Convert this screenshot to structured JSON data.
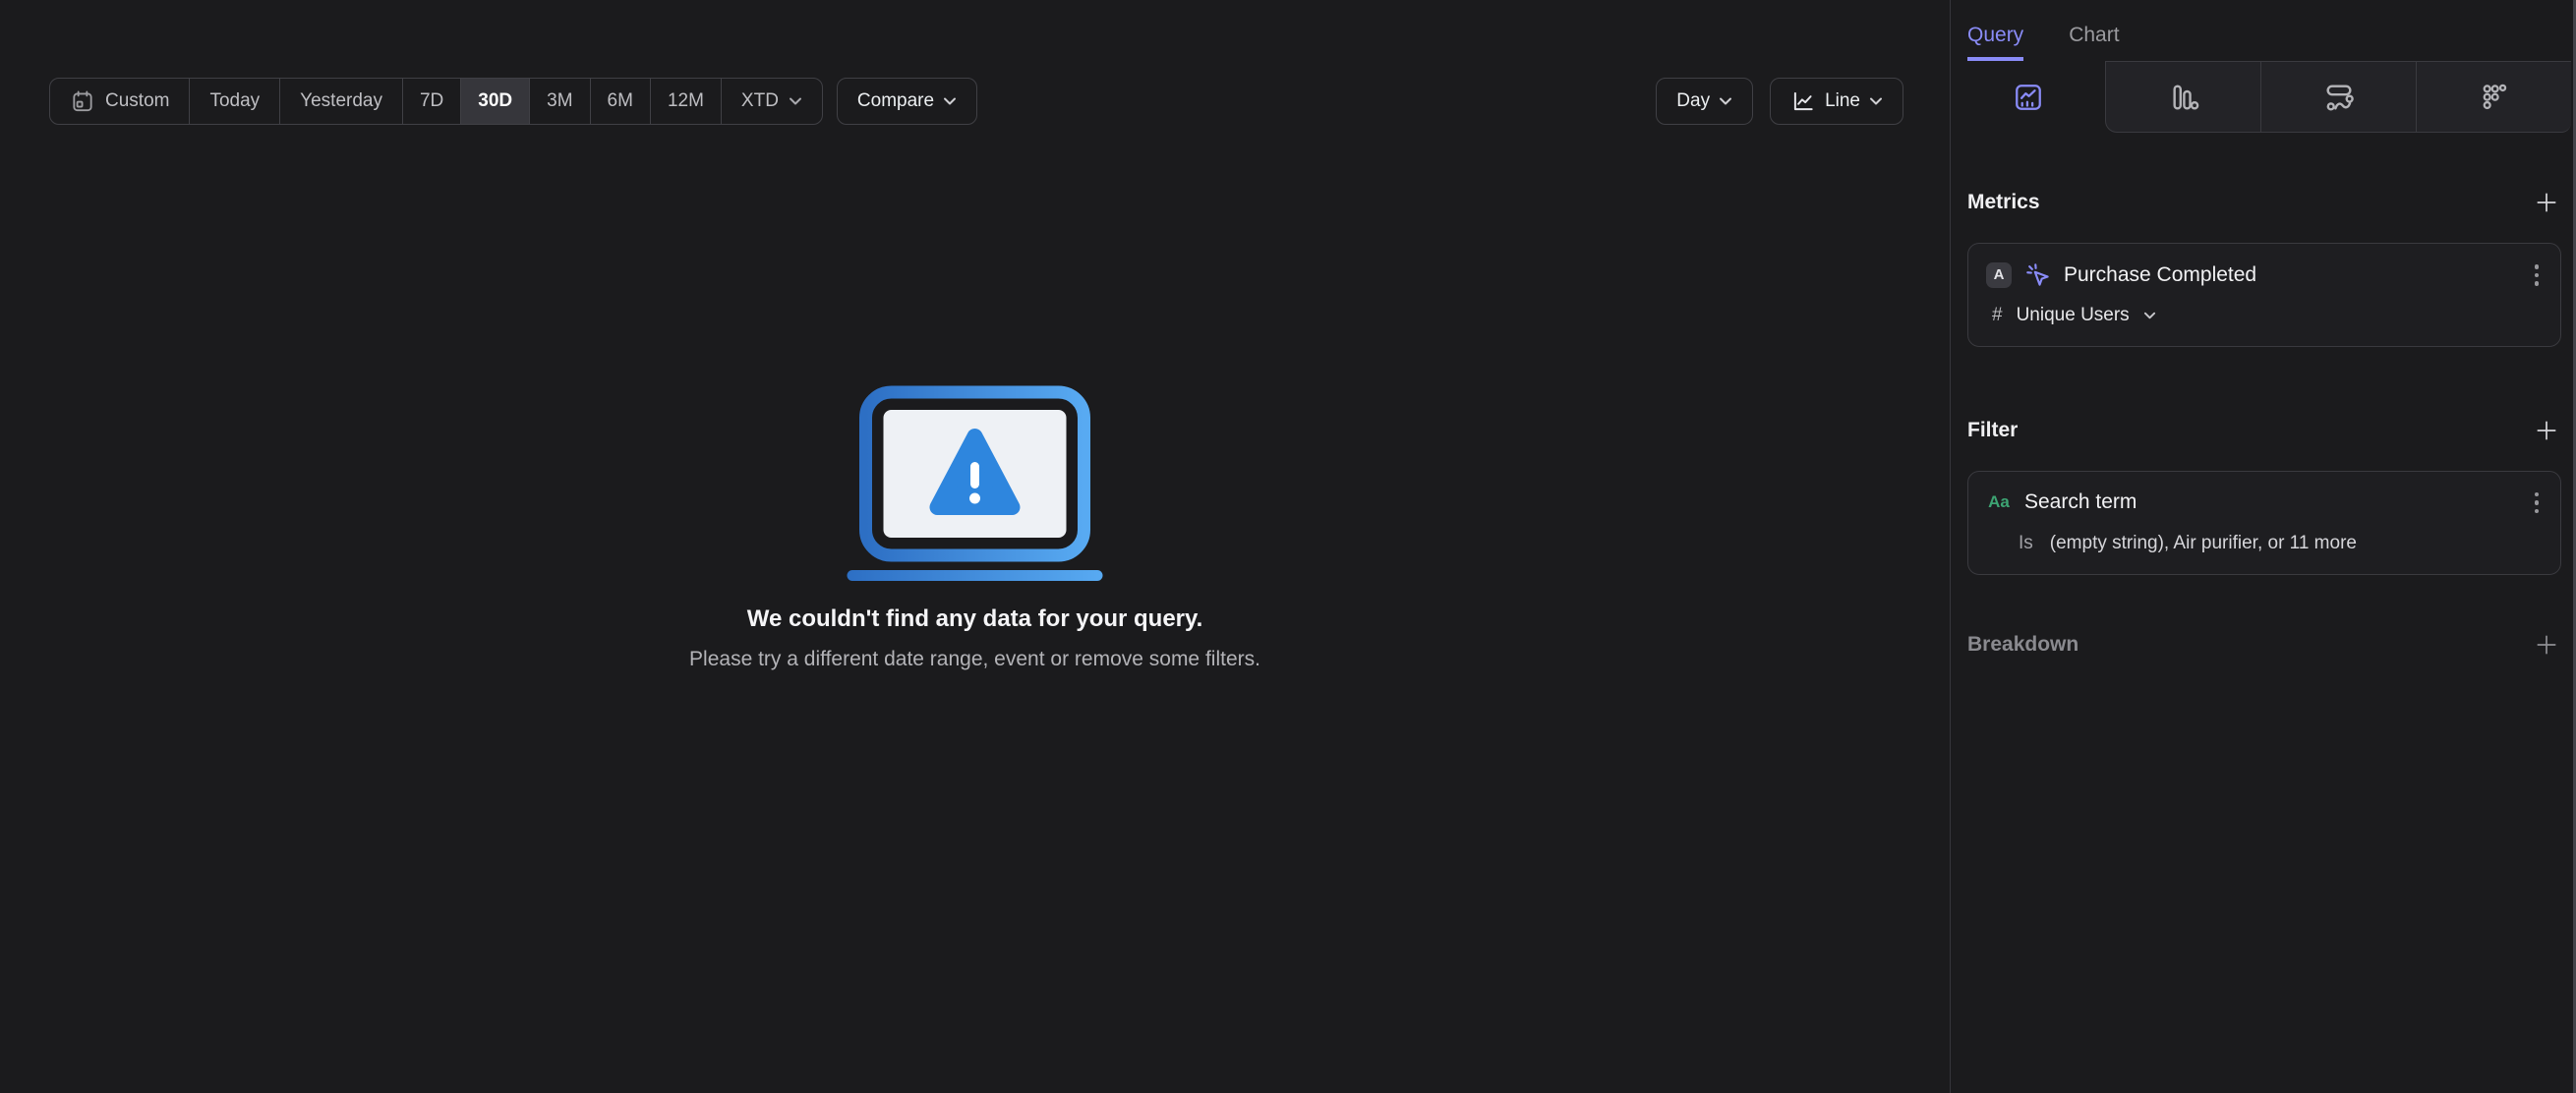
{
  "colors": {
    "accent": "#8a8cf8",
    "green": "#3da473",
    "blue": "#2e86de",
    "blue-dark": "#2d6fc4",
    "blue-light": "#58aaf2",
    "screen": "#eef1f5",
    "selected-bg": "#36363b"
  },
  "toolbar": {
    "segments": [
      {
        "label": "Custom"
      },
      {
        "label": "Today"
      },
      {
        "label": "Yesterday"
      },
      {
        "label": "7D"
      },
      {
        "label": "30D",
        "selected": true
      },
      {
        "label": "3M"
      },
      {
        "label": "6M"
      },
      {
        "label": "12M"
      },
      {
        "label": "XTD"
      }
    ],
    "selected_range": "30D",
    "compare_label": "Compare",
    "granularity_label": "Day",
    "chart_type_label": "Line"
  },
  "empty_state": {
    "title": "We couldn't find any data for your query.",
    "subtitle": "Please try a different date range, event or remove some filters."
  },
  "sidebar": {
    "tabs": [
      {
        "label": "Query"
      },
      {
        "label": "Chart"
      }
    ],
    "active_tab": "Query",
    "chart_type_tabs": [
      "insights-line",
      "bar",
      "flow",
      "dot-grid"
    ],
    "active_chart_type_tab": "insights-line",
    "metrics": {
      "header": "Metrics",
      "items": [
        {
          "letter": "A",
          "event": "Purchase Completed",
          "aggregation_symbol": "#",
          "aggregation": "Unique Users"
        }
      ]
    },
    "filter": {
      "header": "Filter",
      "items": [
        {
          "type": "Aa",
          "property": "Search term",
          "operator": "Is",
          "values_summary": "(empty string), Air purifier, or 11 more"
        }
      ]
    },
    "breakdown": {
      "header": "Breakdown"
    }
  }
}
